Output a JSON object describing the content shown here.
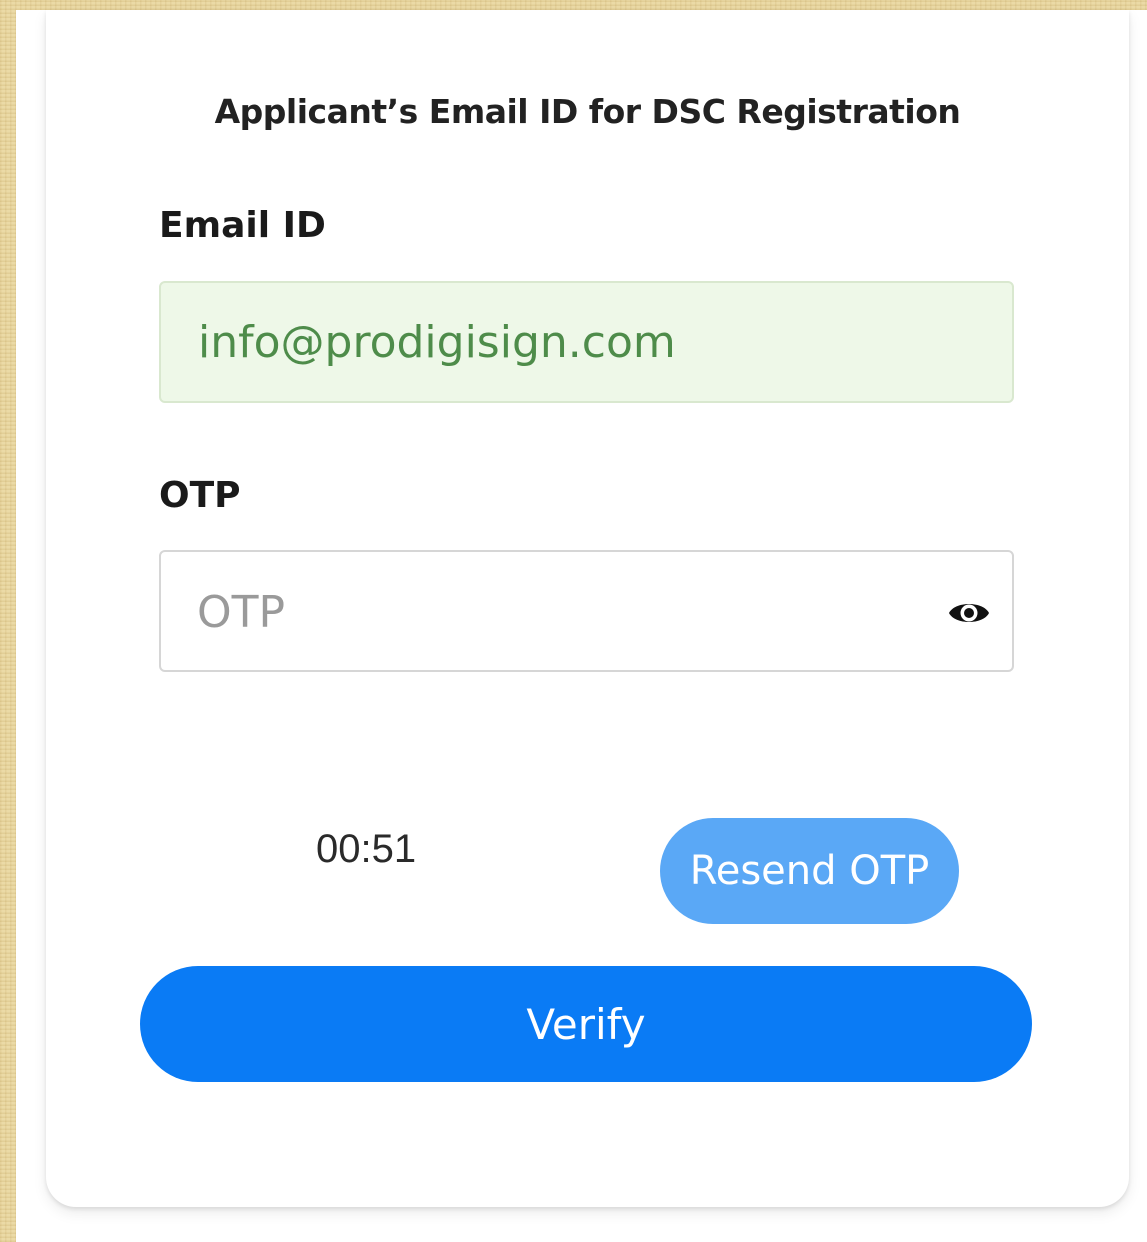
{
  "card": {
    "title": "Applicant’s Email ID for DSC Registration"
  },
  "email": {
    "label": "Email ID",
    "value": "info@prodigisign.com"
  },
  "otp": {
    "label": "OTP",
    "placeholder": "OTP",
    "toggle_icon": "eye-icon"
  },
  "timer": {
    "value": "00:51"
  },
  "buttons": {
    "resend_label": "Resend OTP",
    "verify_label": "Verify"
  },
  "colors": {
    "verify_button": "#0a7bf5",
    "resend_button": "#5aa8f6",
    "email_field_bg": "#eef8e8",
    "email_text": "#4e8c4a",
    "page_background": "#e8d6a0"
  }
}
